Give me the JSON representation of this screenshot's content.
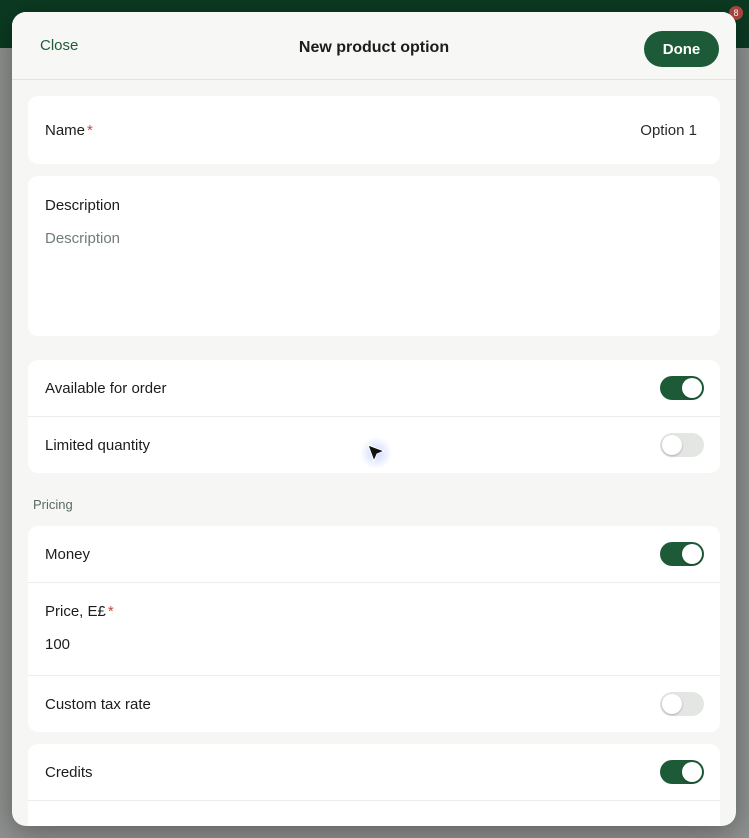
{
  "modal": {
    "close_label": "Close",
    "title": "New product option",
    "done_label": "Done"
  },
  "name_field": {
    "label": "Name",
    "required_mark": "*",
    "value": "Option 1"
  },
  "description_field": {
    "label": "Description",
    "placeholder": "Description"
  },
  "availability": {
    "available_for_order": {
      "label": "Available for order",
      "enabled": true
    },
    "limited_quantity": {
      "label": "Limited quantity",
      "enabled": false
    }
  },
  "pricing": {
    "section_label": "Pricing",
    "money": {
      "label": "Money",
      "enabled": true
    },
    "price": {
      "label": "Price, E£",
      "required_mark": "*",
      "value": "100"
    },
    "custom_tax_rate": {
      "label": "Custom tax rate",
      "enabled": false
    },
    "credits": {
      "label": "Credits",
      "enabled": true
    }
  },
  "background": {
    "notification_badge": "8"
  },
  "colors": {
    "accent": "#1d5b38",
    "required": "#c9473b"
  },
  "icons": {
    "cursor": "cursor-arrow-icon"
  }
}
